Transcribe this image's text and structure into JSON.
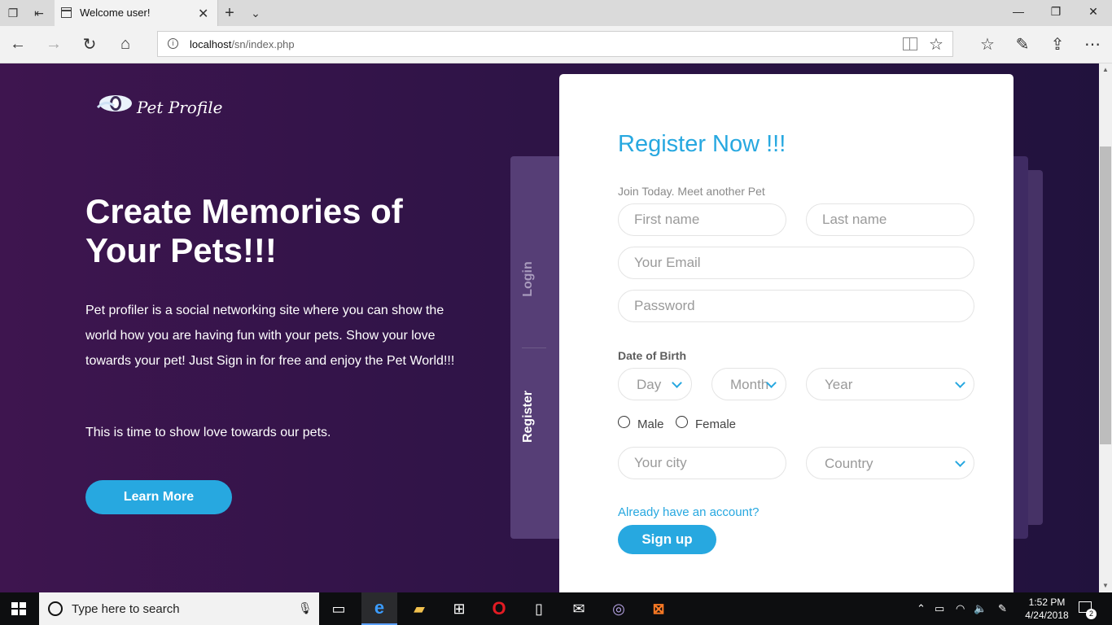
{
  "browser": {
    "tab_title": "Welcome user!",
    "url_host": "localhost",
    "url_path": "/sn/index.php"
  },
  "page": {
    "logo_text": "Pet Profile",
    "hero_title": "Create Memories of Your Pets!!!",
    "hero_description": "Pet profiler is a social networking site where you can show the world how you are having fun with your pets. Show your love towards your pet! Just Sign in for free and enjoy the Pet World!!!",
    "hero_tagline": "This is time to show love towards our pets.",
    "learn_more_label": "Learn More",
    "side_tabs": {
      "login": "Login",
      "register": "Register"
    }
  },
  "form": {
    "title": "Register Now !!!",
    "subtitle": "Join Today. Meet another Pet",
    "first_name_placeholder": "First name",
    "last_name_placeholder": "Last name",
    "email_placeholder": "Your Email",
    "password_placeholder": "Password",
    "dob_label": "Date of Birth",
    "day_label": "Day",
    "month_label": "Month",
    "year_label": "Year",
    "male_label": "Male",
    "female_label": "Female",
    "city_placeholder": "Your city",
    "country_label": "Country",
    "account_link": "Already have an account?",
    "signup_label": "Sign up"
  },
  "taskbar": {
    "search_placeholder": "Type here to search",
    "time": "1:52 PM",
    "date": "4/24/2018",
    "notification_count": "2"
  },
  "colors": {
    "accent": "#27a8e0",
    "page_bg": "#2f1447",
    "side_panel": "#563e76"
  }
}
